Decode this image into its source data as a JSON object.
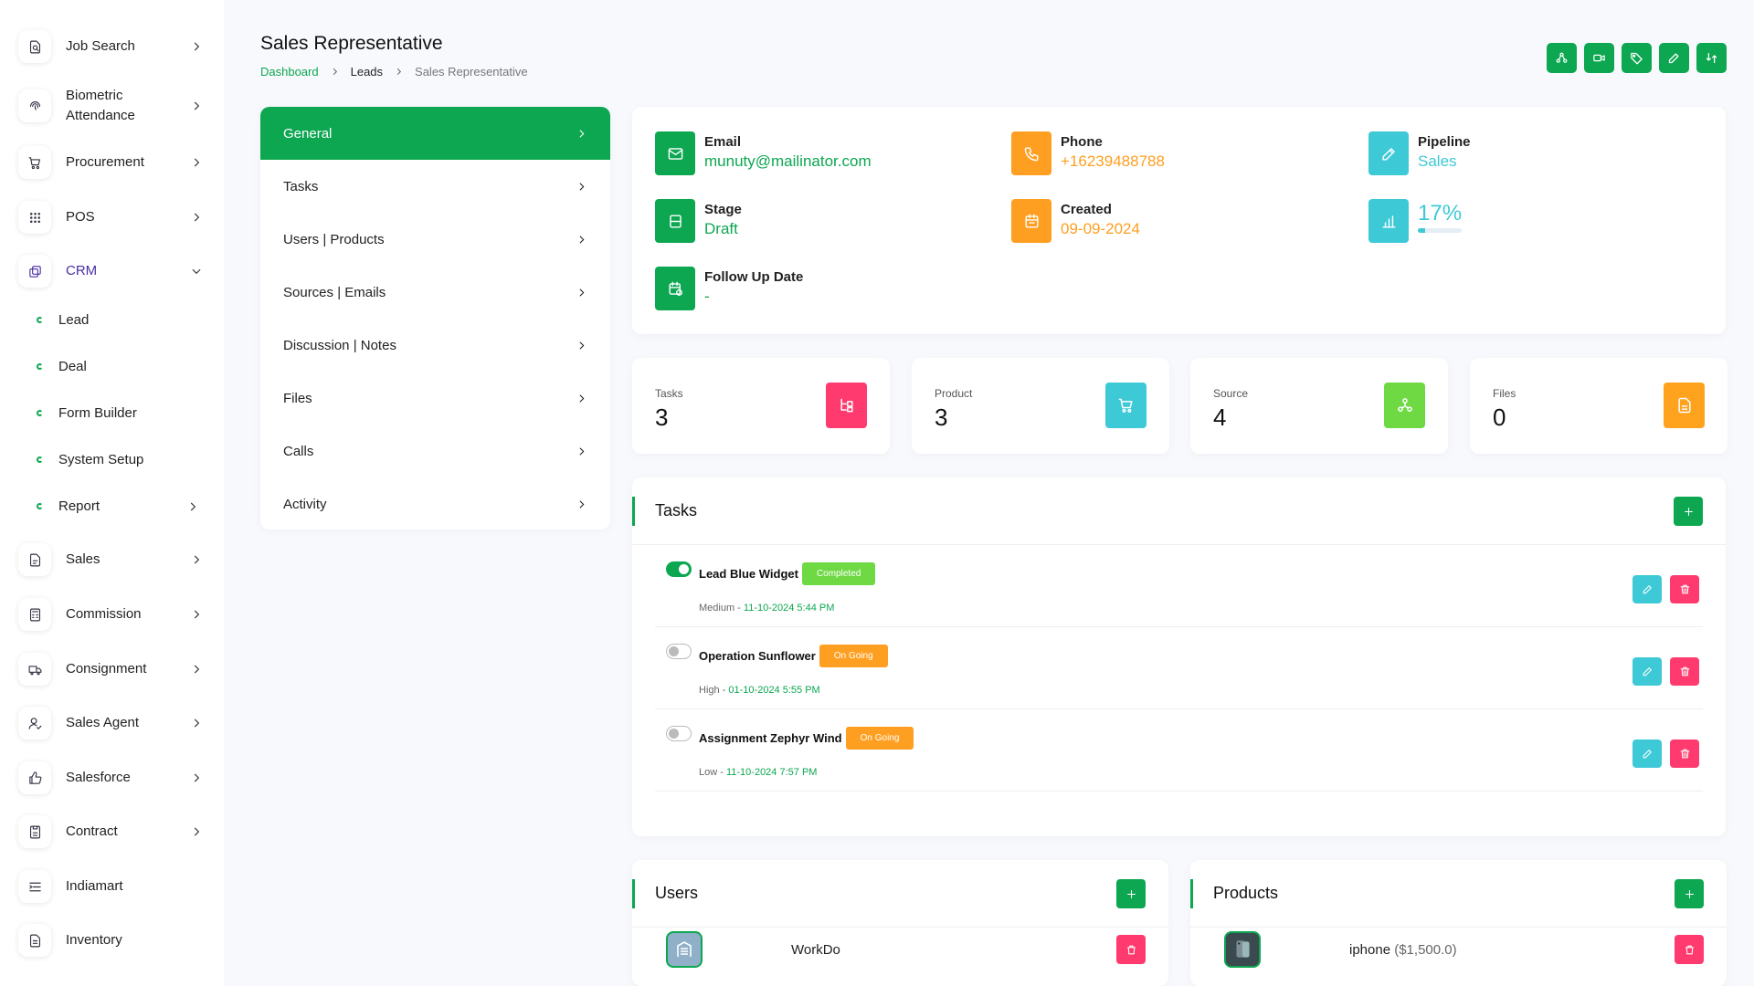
{
  "sidebar": {
    "items": [
      {
        "label": "Job Search",
        "icon": "file-search-icon",
        "chevron": "right"
      },
      {
        "label": "Biometric\nAttendance",
        "icon": "fingerprint-icon",
        "chevron": "right"
      },
      {
        "label": "Procurement",
        "icon": "cart-icon",
        "chevron": "right"
      },
      {
        "label": "POS",
        "icon": "grid-icon",
        "chevron": "right"
      },
      {
        "label": "CRM",
        "icon": "crm-icon",
        "chevron": "down"
      },
      {
        "label": "Sales",
        "icon": "document-icon",
        "chevron": "right"
      },
      {
        "label": "Commission",
        "icon": "calculator-icon",
        "chevron": "right"
      },
      {
        "label": "Consignment",
        "icon": "truck-icon",
        "chevron": "right"
      },
      {
        "label": "Sales Agent",
        "icon": "user-check-icon",
        "chevron": "right"
      },
      {
        "label": "Salesforce",
        "icon": "thumbs-up-icon",
        "chevron": "right"
      },
      {
        "label": "Contract",
        "icon": "contract-icon",
        "chevron": "right"
      },
      {
        "label": "Indiamart",
        "icon": "list-icon",
        "chevron": ""
      },
      {
        "label": "Inventory",
        "icon": "inventory-icon",
        "chevron": ""
      }
    ],
    "crm_sub": [
      "Lead",
      "Deal",
      "Form Builder",
      "System Setup",
      "Report"
    ]
  },
  "header": {
    "title": "Sales Representative",
    "breadcrumb": [
      "Dashboard",
      "Leads",
      "Sales Representative"
    ],
    "actions": [
      "share-icon",
      "video-icon",
      "tag-icon",
      "edit-icon",
      "exchange-icon"
    ]
  },
  "menu": [
    "General",
    "Tasks",
    "Users | Products",
    "Sources | Emails",
    "Discussion | Notes",
    "Files",
    "Calls",
    "Activity"
  ],
  "info": {
    "email_label": "Email",
    "email": "munuty@mailinator.com",
    "phone_label": "Phone",
    "phone": "+16239488788",
    "pipeline_label": "Pipeline",
    "pipeline": "Sales",
    "stage_label": "Stage",
    "stage": "Draft",
    "created_label": "Created",
    "created": "09-09-2024",
    "progress": "17%",
    "progress_fraction": 0.17,
    "followup_label": "Follow Up Date",
    "followup": "-"
  },
  "stats": [
    {
      "label": "Tasks",
      "value": "3",
      "color": "#ff3a6e"
    },
    {
      "label": "Product",
      "value": "3",
      "color": "#3ec9d6"
    },
    {
      "label": "Source",
      "value": "4",
      "color": "#6fd943"
    },
    {
      "label": "Files",
      "value": "0",
      "color": "#ffa21d"
    }
  ],
  "tasks": {
    "title": "Tasks",
    "rows": [
      {
        "name": "Lead Blue Widget",
        "status": "Completed",
        "priority": "Medium",
        "date": "11-10-2024 5:44 PM",
        "done": true
      },
      {
        "name": "Operation Sunflower",
        "status": "On Going",
        "priority": "High",
        "date": "01-10-2024 5:55 PM",
        "done": false
      },
      {
        "name": "Assignment Zephyr Wind",
        "status": "On Going",
        "priority": "Low",
        "date": "11-10-2024 7:57 PM",
        "done": false
      }
    ]
  },
  "users": {
    "title": "Users",
    "items": [
      {
        "name": "WorkDo"
      }
    ]
  },
  "products": {
    "title": "Products",
    "items": [
      {
        "name": "iphone",
        "price": "($1,500.0)"
      }
    ]
  },
  "colors": {
    "accent": "#0ca750",
    "orange": "#fe9f21",
    "teal": "#3ec9d6",
    "red": "#ff3a6e"
  }
}
